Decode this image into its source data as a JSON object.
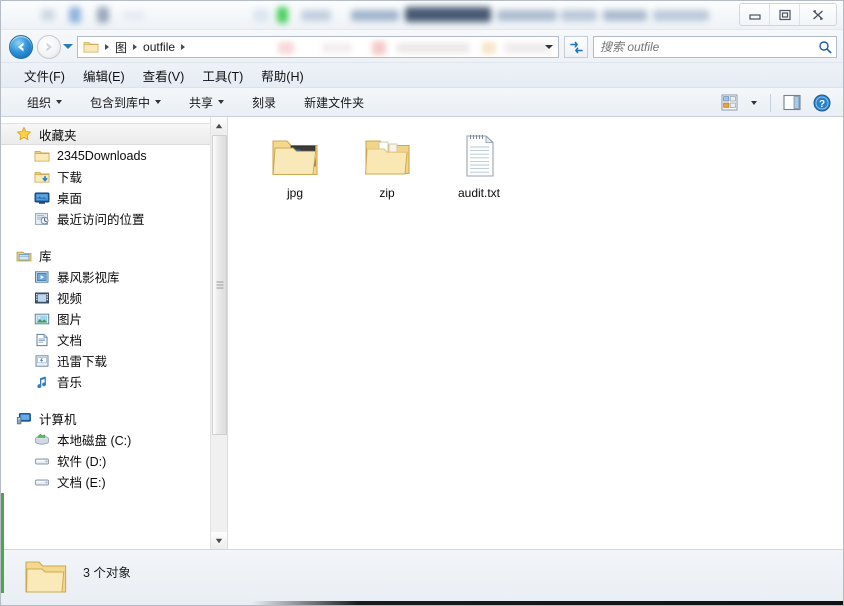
{
  "window": {
    "title_obscured": true,
    "controls": {
      "minimize_label": "最小化",
      "restore_label": "向下还原",
      "close_label": "关闭"
    }
  },
  "address_bar": {
    "back_label": "后退",
    "forward_label": "前进",
    "recent_pages_label": "最近浏览的页面",
    "breadcrumb": [
      {
        "label": "",
        "icon": "folder-icon"
      },
      {
        "label": "图",
        "icon": ""
      },
      {
        "label": "outfile",
        "icon": ""
      }
    ],
    "refresh_label": "刷新",
    "search": {
      "placeholder": "搜索 outfile",
      "value": "",
      "icon": "search-icon"
    }
  },
  "menu": {
    "items": [
      {
        "label": "文件(F)"
      },
      {
        "label": "编辑(E)"
      },
      {
        "label": "查看(V)"
      },
      {
        "label": "工具(T)"
      },
      {
        "label": "帮助(H)"
      }
    ]
  },
  "toolbar": {
    "buttons": [
      {
        "label": "组织",
        "has_caret": true
      },
      {
        "label": "包含到库中",
        "has_caret": true
      },
      {
        "label": "共享",
        "has_caret": true
      },
      {
        "label": "刻录",
        "has_caret": false
      },
      {
        "label": "新建文件夹",
        "has_caret": false
      }
    ],
    "right_icons": [
      {
        "name": "change-view-icon",
        "label": "更改您的视图"
      },
      {
        "name": "chevron-down-icon",
        "label": "视图选项"
      },
      {
        "name": "preview-pane-icon",
        "label": "显示预览窗格"
      },
      {
        "name": "help-icon",
        "label": "获取帮助"
      }
    ]
  },
  "sidebar": {
    "groups": [
      {
        "header": {
          "label": "收藏夹",
          "icon": "star-icon",
          "selected": true
        },
        "items": [
          {
            "label": "2345Downloads",
            "icon": "folder-icon"
          },
          {
            "label": "下载",
            "icon": "download-folder-icon"
          },
          {
            "label": "桌面",
            "icon": "desktop-icon"
          },
          {
            "label": "最近访问的位置",
            "icon": "recent-places-icon"
          }
        ]
      },
      {
        "header": {
          "label": "库",
          "icon": "library-icon",
          "selected": false
        },
        "items": [
          {
            "label": "暴风影视库",
            "icon": "video-library-icon"
          },
          {
            "label": "视频",
            "icon": "film-icon"
          },
          {
            "label": "图片",
            "icon": "picture-icon"
          },
          {
            "label": "文档",
            "icon": "document-icon"
          },
          {
            "label": "迅雷下载",
            "icon": "thunder-download-icon"
          },
          {
            "label": "音乐",
            "icon": "music-note-icon"
          }
        ]
      },
      {
        "header": {
          "label": "计算机",
          "icon": "computer-icon",
          "selected": false
        },
        "items": [
          {
            "label": "本地磁盘 (C:)",
            "icon": "system-drive-icon"
          },
          {
            "label": "软件 (D:)",
            "icon": "drive-icon"
          },
          {
            "label": "文档 (E:)",
            "icon": "drive-icon"
          }
        ]
      }
    ],
    "scrollbar": {
      "up_label": "向上滚动",
      "down_label": "向下滚动"
    }
  },
  "files": {
    "items": [
      {
        "name": "jpg",
        "icon": "folder-with-photo-icon",
        "type": "folder"
      },
      {
        "name": "zip",
        "icon": "folder-with-files-icon",
        "type": "folder"
      },
      {
        "name": "audit.txt",
        "icon": "text-document-icon",
        "type": "file"
      }
    ]
  },
  "status_bar": {
    "icon": "folder-icon",
    "text": "3 个对象"
  },
  "colors": {
    "accent_blue": "#2f95da",
    "folder_yellow": "#f6d98a",
    "window_chrome": "#eef2f8",
    "pane_background": "#ffffff",
    "status_green": "#4aa84a"
  }
}
